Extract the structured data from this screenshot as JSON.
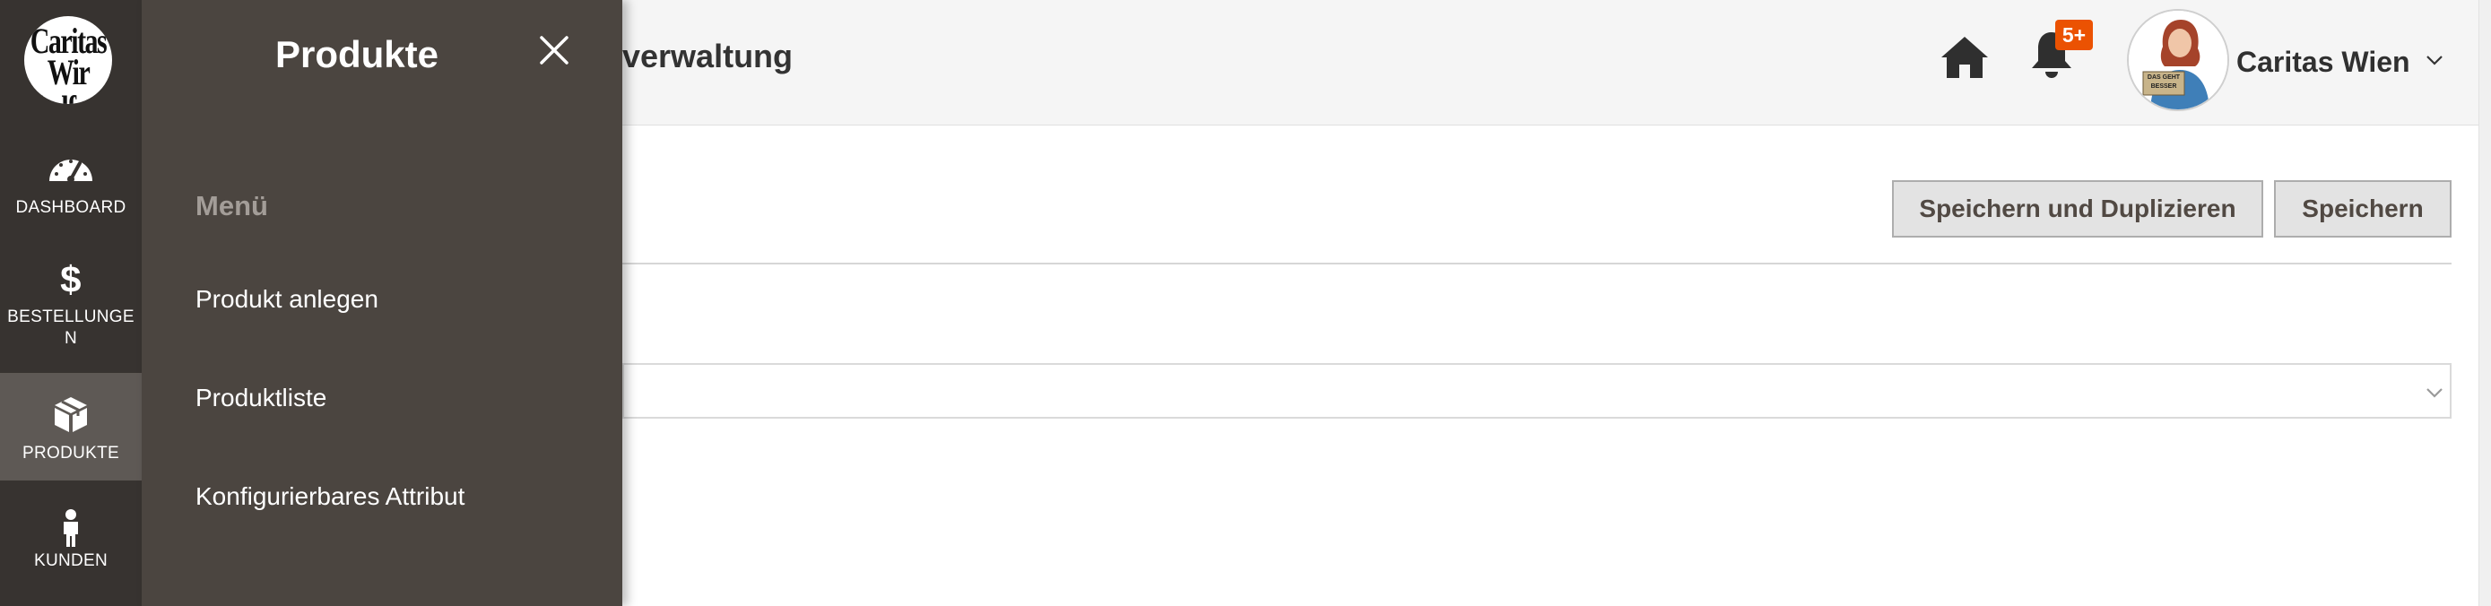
{
  "rail": {
    "logo_lines": [
      "Caritas",
      "Wir helfen"
    ],
    "items": [
      {
        "label": "DASHBOARD",
        "icon": "dashboard-gauge-icon"
      },
      {
        "label": "BESTELLUNGE\nN",
        "icon": "dollar-icon",
        "glyph": "$"
      },
      {
        "label": "PRODUKTE",
        "icon": "box-icon",
        "active": true
      },
      {
        "label": "KUNDEN",
        "icon": "person-icon"
      }
    ]
  },
  "flyout": {
    "title": "Produkte",
    "section": "Menü",
    "links": [
      "Produkt anlegen",
      "Produktliste",
      "Konfigurierbares Attribut"
    ]
  },
  "header": {
    "title": "verwaltung",
    "notifications_badge": "5+",
    "account_name": "Caritas Wien",
    "avatar_sign_text": [
      "DAS GEHT",
      "BESSER"
    ]
  },
  "actions": {
    "save_duplicate": "Speichern und Duplizieren",
    "save": "Speichern"
  },
  "colors": {
    "rail_bg": "#373330",
    "flyout_bg": "#4b4540",
    "active_item_bg": "#5e5955",
    "badge": "#eb5202",
    "button_bg": "#e3e3e3"
  }
}
